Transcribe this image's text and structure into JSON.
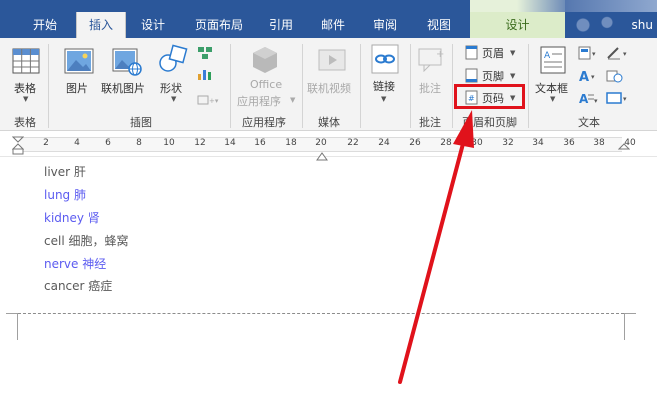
{
  "tabs": [
    "开始",
    "插入",
    "设计",
    "页面布局",
    "引用",
    "邮件",
    "审阅",
    "视图",
    "设计"
  ],
  "user": "shu",
  "ribbon": {
    "groups": {
      "tables": "表格",
      "illustrations": "插图",
      "apps": "应用程序",
      "media": "媒体",
      "comments": "批注",
      "header_footer": "页眉和页脚",
      "text": "文本"
    },
    "buttons": {
      "table": "表格",
      "picture": "图片",
      "online_picture": "联机图片",
      "shapes": "形状",
      "office_line1": "Office",
      "office_line2": "应用程序",
      "online_video": "联机视频",
      "link": "链接",
      "comment": "批注",
      "header": "页眉",
      "footer": "页脚",
      "page_number": "页码",
      "text_box": "文本框"
    }
  },
  "ruler": {
    "numbers": [
      "2",
      "4",
      "6",
      "8",
      "10",
      "12",
      "14",
      "16",
      "18",
      "20",
      "22",
      "24",
      "26",
      "28",
      "30",
      "32",
      "34",
      "36",
      "38",
      "40"
    ]
  },
  "document": {
    "lines": [
      {
        "text": "liver 肝",
        "style": "dark"
      },
      {
        "text": "lung 肺",
        "style": "blue"
      },
      {
        "text": "kidney 肾",
        "style": "blue"
      },
      {
        "text": "cell 细胞，蜂窝",
        "style": "dark"
      },
      {
        "text": "nerve 神经",
        "style": "blue"
      },
      {
        "text": "cancer 癌症",
        "style": "dark"
      }
    ]
  },
  "colors": {
    "accent": "#2b579a",
    "annotation_red": "#e0121b",
    "doc_blue": "#5b5bf0"
  }
}
